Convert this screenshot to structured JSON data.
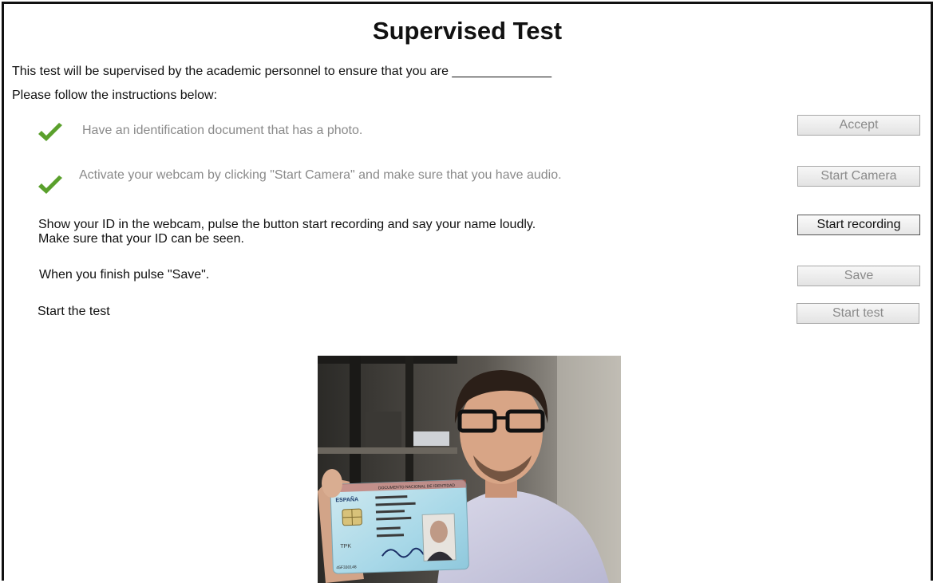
{
  "page": {
    "title": "Supervised Test",
    "intro_line": "This test will be supervised by the academic personnel to ensure that you are ______________",
    "instructions_line": "Please follow the instructions below:"
  },
  "steps": [
    {
      "text": "Have an identification document that has a photo.",
      "status": "done",
      "button": "Accept",
      "button_enabled": false
    },
    {
      "text": "Activate your webcam by clicking \"Start Camera\" and make sure that you have audio.",
      "status": "done",
      "button": "Start Camera",
      "button_enabled": false
    },
    {
      "text_line1": "Show your ID in the webcam, pulse the button start recording and say your name loudly.",
      "text_line2": "Make sure that your ID can be seen.",
      "status": "active",
      "button": "Start recording",
      "button_enabled": true
    },
    {
      "text": "When you finish pulse \"Save\".",
      "status": "pending",
      "button": "Save",
      "button_enabled": false
    },
    {
      "text": "Start the test",
      "status": "pending",
      "button": "Start test",
      "button_enabled": false
    }
  ],
  "webcam": {
    "card_country": "ESPAÑA",
    "card_header": "DOCUMENTO NACIONAL DE IDENTIDAD",
    "card_label": "TPK",
    "card_number": "45F330148"
  },
  "colors": {
    "check_green": "#5aa02c",
    "done_text": "#8a8a8a",
    "active_text": "#111111"
  }
}
